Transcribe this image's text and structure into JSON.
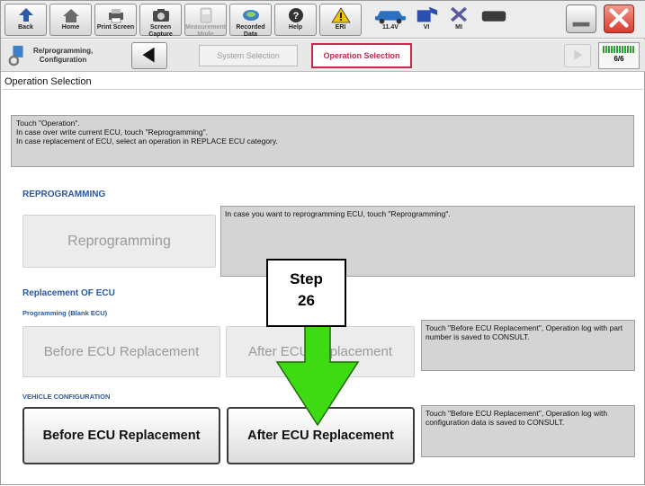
{
  "toolbar": {
    "back": "Back",
    "home": "Home",
    "print_screen": "Print Screen",
    "screen_capture": "Screen Capture",
    "measurement_mode": "Measurement Mode",
    "recorded_data": "Recorded Data",
    "help": "Help",
    "eri": "ERI",
    "battery_voltage": "11.4V",
    "vi": "VI",
    "mi": "MI"
  },
  "navbar": {
    "reprogramming_crumb": "Re/programming, Configuration",
    "system_selection": "System Selection",
    "operation_selection": "Operation Selection",
    "page": "6/6"
  },
  "screen_title": "Operation Selection",
  "instructions": [
    "Touch \"Operation\".",
    "In case over write current ECU, touch \"Reprogramming\".",
    "In case replacement of ECU, select an operation in REPLACE ECU category."
  ],
  "reprogramming": {
    "heading": "REPROGRAMMING",
    "button": "Reprogramming",
    "description": "In case you want to reprogramming ECU, touch \"Reprogramming\"."
  },
  "replacement": {
    "heading": "Replacement OF ECU",
    "blank_sub": "Programming (Blank ECU)",
    "blank_before": "Before ECU Replacement",
    "blank_after": "After ECU Replacement",
    "blank_desc": "Touch \"Before ECU Replacement\", Operation log with part number is saved to CONSULT.",
    "vehicle_sub": "VEHICLE CONFIGURATION",
    "vehicle_before": "Before ECU Replacement",
    "vehicle_after": "After ECU Replacement",
    "vehicle_desc": "Touch \"Before ECU Replacement\", Operation log with configuration data is saved to CONSULT."
  },
  "callout": {
    "step_word": "Step",
    "step_number": "26"
  },
  "colors": {
    "accent_red": "#c8264a",
    "section_blue": "#2a57a0",
    "arrow_green": "#3fdb12",
    "close_red": "#e0352c"
  }
}
